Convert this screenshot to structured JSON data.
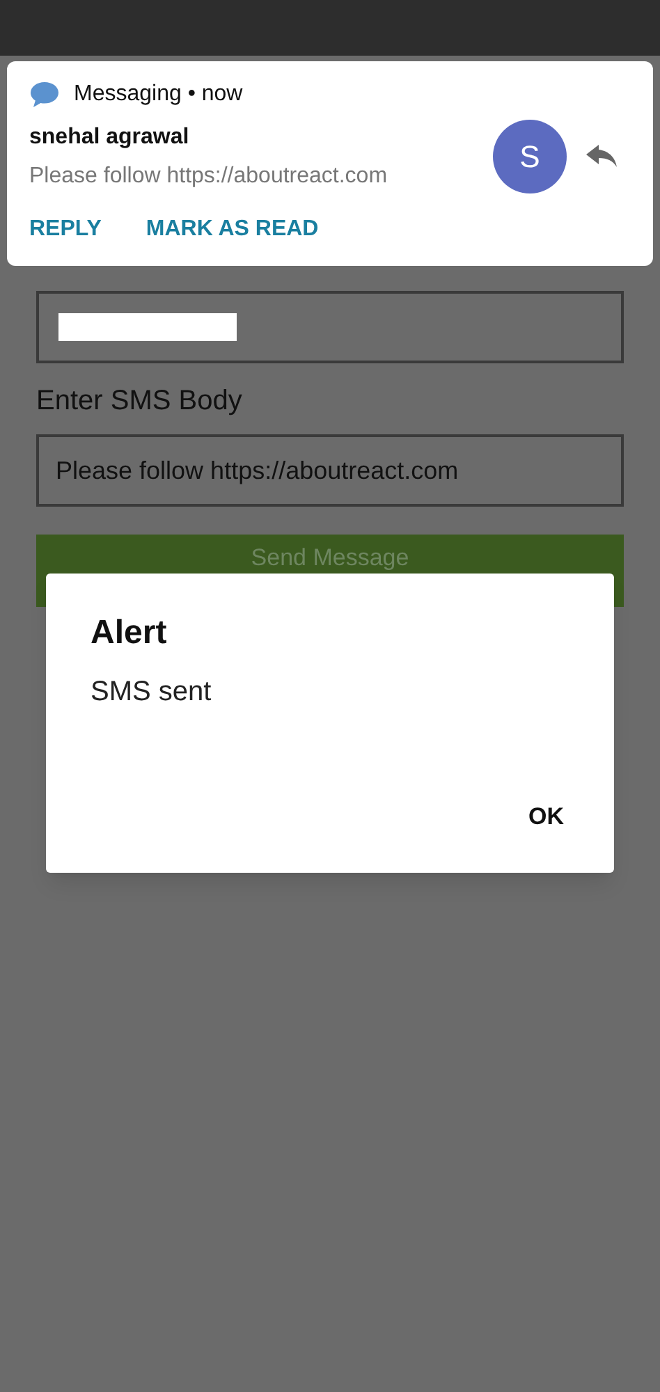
{
  "notification": {
    "app": "Messaging",
    "separator": "•",
    "time": "now",
    "sender": "snehal agrawal",
    "message": "Please follow https://aboutreact.com",
    "avatar_letter": "S",
    "actions": [
      "REPLY",
      "MARK AS READ"
    ]
  },
  "form": {
    "phone_value_redacted": true,
    "body_label": "Enter SMS Body",
    "body_value": "Please follow https://aboutreact.com",
    "send_button": "Send Message"
  },
  "dialog": {
    "title": "Alert",
    "message": "SMS sent",
    "button": "OK"
  }
}
